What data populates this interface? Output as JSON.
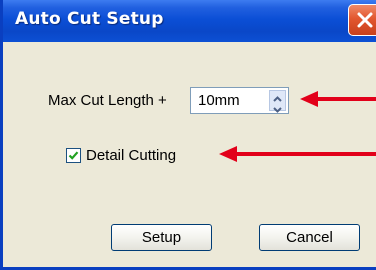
{
  "window": {
    "title": "Auto Cut Setup"
  },
  "form": {
    "max_cut_label": "Max Cut Length +",
    "max_cut_value": "10mm",
    "detail_cutting_label": "Detail Cutting",
    "detail_cutting_checked": true
  },
  "buttons": {
    "setup_label": "Setup",
    "cancel_label": "Cancel"
  },
  "icons": {
    "close": "close-icon",
    "spin_up": "chevron-up-icon",
    "spin_down": "chevron-down-icon",
    "check": "checkmark-icon",
    "annotation_arrow": "arrow-left-icon"
  },
  "colors": {
    "titlebar": "#0a47c8",
    "close_button": "#e2572f",
    "dialog_background": "#ece9d8",
    "annotation_arrow": "#e2001a"
  }
}
